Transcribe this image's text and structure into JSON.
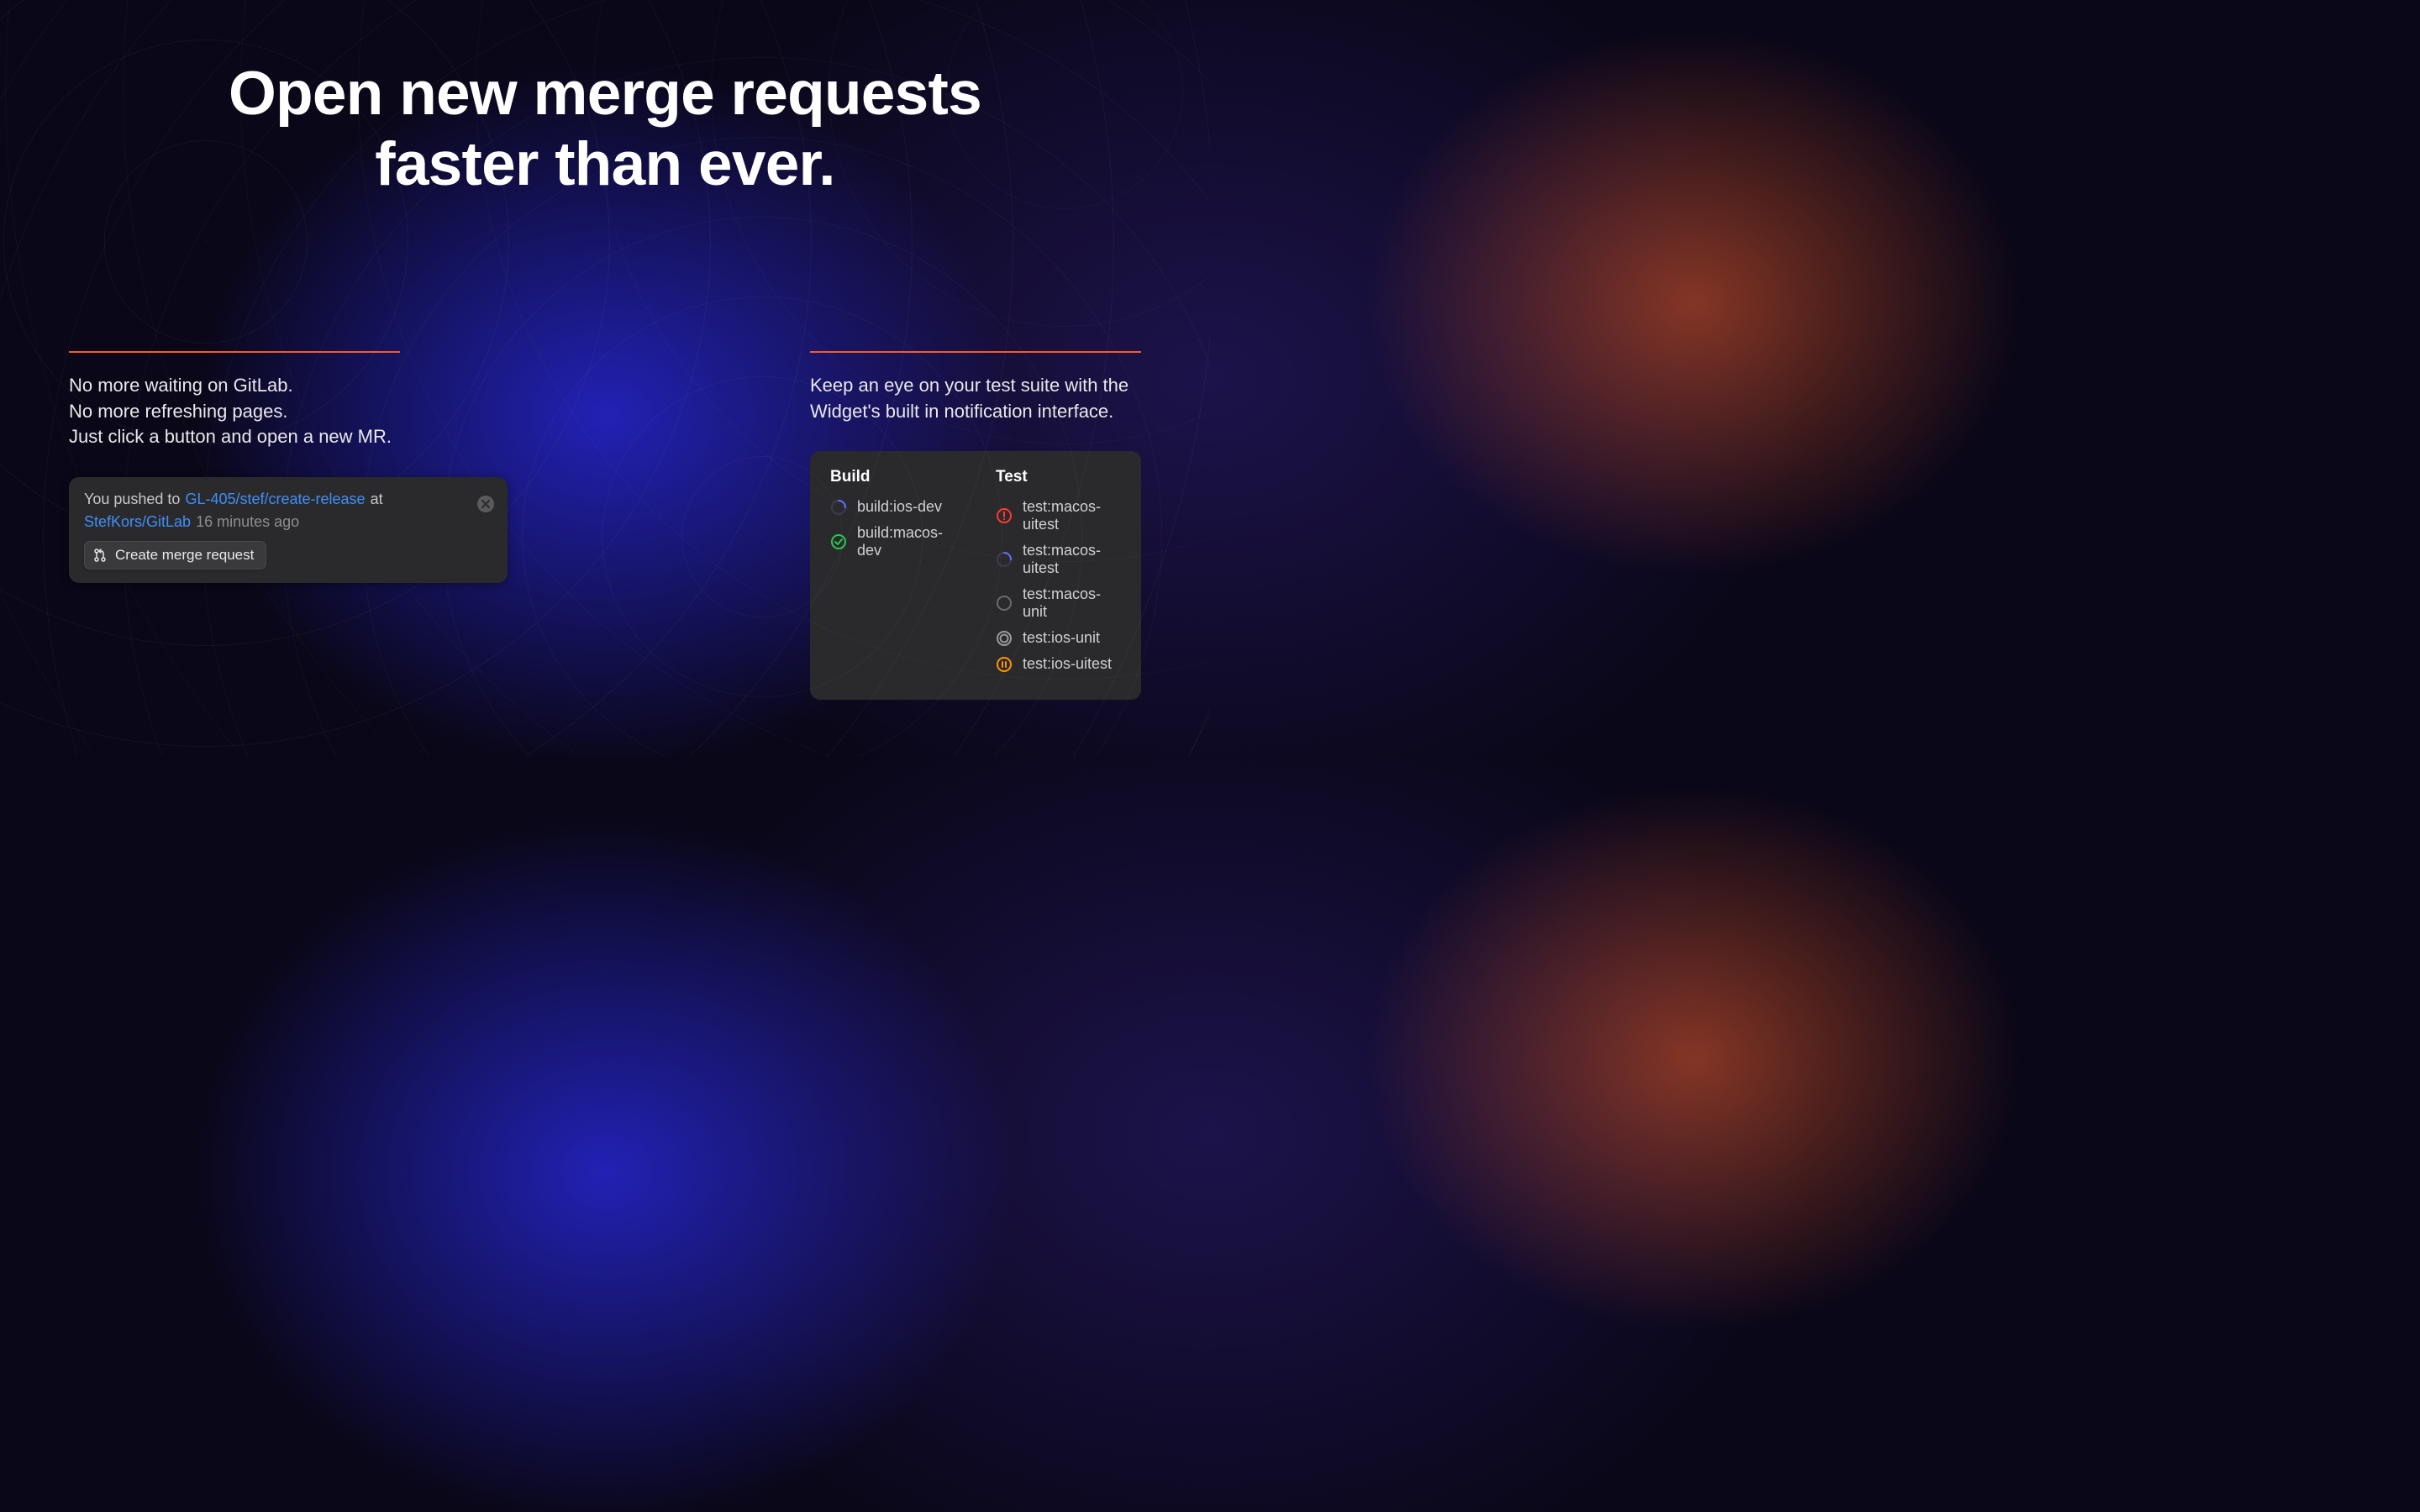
{
  "headline": {
    "line1": "Open new merge requests",
    "line2": "faster than ever."
  },
  "left": {
    "desc_line1": "No more waiting on GitLab.",
    "desc_line2": "No more refreshing pages.",
    "desc_line3": "Just click a button and open a new MR.",
    "push": {
      "prefix": "You pushed to",
      "branch": "GL-405/stef/create-release",
      "at": "at",
      "repo": "StefKors/GitLab",
      "time": "16 minutes ago"
    },
    "button_label": "Create merge request"
  },
  "right": {
    "desc_line1": "Keep an eye on your test suite with the",
    "desc_line2": "Widget's built in notification interface.",
    "build": {
      "heading": "Build",
      "jobs": [
        {
          "status": "running",
          "label": "build:ios-dev"
        },
        {
          "status": "success",
          "label": "build:macos-dev"
        }
      ]
    },
    "test": {
      "heading": "Test",
      "jobs": [
        {
          "status": "failed",
          "label": "test:macos-uitest"
        },
        {
          "status": "running",
          "label": "test:macos-uitest"
        },
        {
          "status": "pending",
          "label": "test:macos-unit"
        },
        {
          "status": "skipped",
          "label": "test:ios-unit"
        },
        {
          "status": "paused",
          "label": "test:ios-uitest"
        }
      ]
    }
  },
  "colors": {
    "accent": "#f55a2c",
    "link": "#3f8ff7",
    "success": "#2bc553",
    "failed": "#ff3b30",
    "running": "#4a5dd8",
    "paused": "#ff9500",
    "muted": "#8e8e92"
  }
}
